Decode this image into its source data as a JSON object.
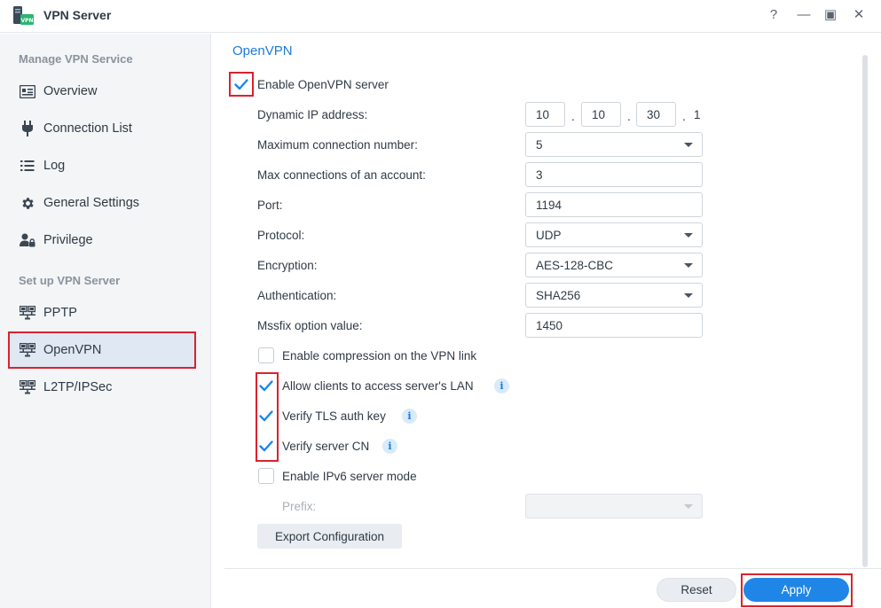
{
  "window": {
    "title": "VPN Server",
    "icon_label": "VPN",
    "controls": [
      "?",
      "—",
      "▣",
      "✕"
    ]
  },
  "sidebar": {
    "sections": [
      {
        "title": "Manage VPN Service",
        "items": [
          {
            "label": "Overview",
            "icon": "overview-icon"
          },
          {
            "label": "Connection List",
            "icon": "plug-icon"
          },
          {
            "label": "Log",
            "icon": "list-icon"
          },
          {
            "label": "General Settings",
            "icon": "gear-icon"
          },
          {
            "label": "Privilege",
            "icon": "user-lock-icon"
          }
        ]
      },
      {
        "title": "Set up VPN Server",
        "items": [
          {
            "label": "PPTP",
            "icon": "network-icon"
          },
          {
            "label": "OpenVPN",
            "icon": "network-icon",
            "active": true
          },
          {
            "label": "L2TP/IPSec",
            "icon": "network-icon"
          }
        ]
      }
    ]
  },
  "openvpn": {
    "section_title": "OpenVPN",
    "enable_label": "Enable OpenVPN server",
    "enable_checked": true,
    "dynamic_ip": {
      "label": "Dynamic IP address:",
      "octets": [
        "10",
        "10",
        "30"
      ],
      "dot": ".",
      "last_octet": "1"
    },
    "max_connection": {
      "label": "Maximum connection number:",
      "value": "5"
    },
    "max_account": {
      "label": "Max connections of an account:",
      "value": "3"
    },
    "port": {
      "label": "Port:",
      "value": "1194"
    },
    "protocol": {
      "label": "Protocol:",
      "value": "UDP"
    },
    "encryption": {
      "label": "Encryption:",
      "value": "AES-128-CBC"
    },
    "authentication": {
      "label": "Authentication:",
      "value": "SHA256"
    },
    "mssfix": {
      "label": "Mssfix option value:",
      "value": "1450"
    },
    "options": [
      {
        "label": "Enable compression on the VPN link",
        "checked": false,
        "info": false
      },
      {
        "label": "Allow clients to access server's LAN",
        "checked": true,
        "info": true
      },
      {
        "label": "Verify TLS auth key",
        "checked": true,
        "info": true
      },
      {
        "label": "Verify server CN",
        "checked": true,
        "info": true
      },
      {
        "label": "Enable IPv6 server mode",
        "checked": false,
        "info": false
      }
    ],
    "prefix": {
      "label": "Prefix:",
      "value": ""
    },
    "info_glyph": "i",
    "export_label": "Export Configuration"
  },
  "footer": {
    "reset_label": "Reset",
    "apply_label": "Apply"
  },
  "colors": {
    "accent": "#1f86e8",
    "highlight": "#d9232e",
    "sidebar_bg": "#f3f5f7"
  }
}
